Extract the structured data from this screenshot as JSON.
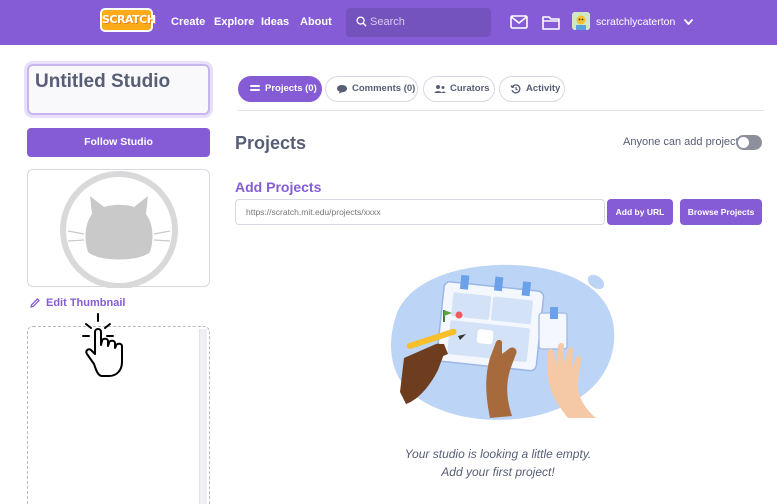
{
  "nav": {
    "logo": "SCRATCH",
    "links": [
      "Create",
      "Explore",
      "Ideas",
      "About"
    ],
    "search_placeholder": "Search",
    "username": "scratchlycaterton",
    "brand_color": "#855cd6"
  },
  "studio": {
    "title": "Untitled Studio",
    "follow_label": "Follow Studio",
    "edit_thumbnail_label": "Edit Thumbnail"
  },
  "tabs": [
    {
      "label": "Projects (0)",
      "icon": "projects-icon",
      "active": true
    },
    {
      "label": "Comments (0)",
      "icon": "comment-bubble-icon",
      "active": false
    },
    {
      "label": "Curators",
      "icon": "curators-icon",
      "active": false
    },
    {
      "label": "Activity",
      "icon": "activity-icon",
      "active": false
    }
  ],
  "main": {
    "heading": "Projects",
    "anyone_label": "Anyone can add projects",
    "anyone_toggle_on": false,
    "add_heading": "Add Projects",
    "url_placeholder": "https://scratch.mit.edu/projects/xxxx",
    "add_by_url_label": "Add by URL",
    "browse_label": "Browse Projects",
    "empty_line1": "Your studio is looking a little empty.",
    "empty_line2": "Add your first project!"
  }
}
